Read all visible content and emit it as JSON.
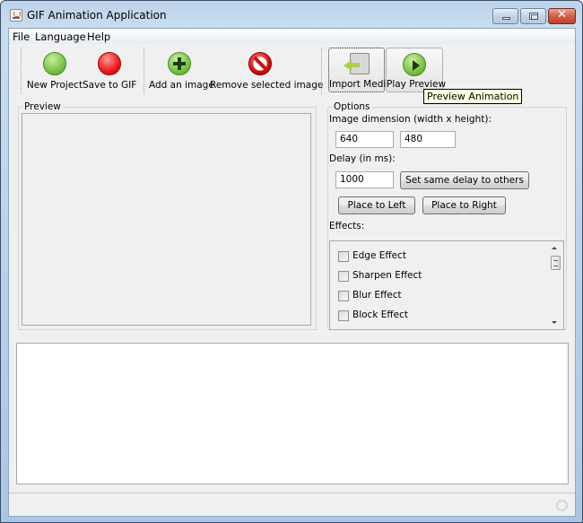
{
  "window": {
    "title": "GIF Animation Application",
    "controls": {
      "minimize_icon": "minimize-icon",
      "maximize_icon": "maximize-icon",
      "close_glyph": "✕"
    }
  },
  "menubar": {
    "items": [
      {
        "label": "File"
      },
      {
        "label": "Language"
      },
      {
        "label": "Help"
      }
    ]
  },
  "toolbar": {
    "buttons": [
      {
        "label": "New Project",
        "icon": "green-circle-icon"
      },
      {
        "label": "Save to GIF",
        "icon": "red-circle-icon"
      },
      {
        "label": "Add an image",
        "icon": "add-icon"
      },
      {
        "label": "Remove selected image",
        "icon": "no-sign-icon"
      },
      {
        "label": "Import Media",
        "icon": "import-media-icon"
      },
      {
        "label": "Play Preview",
        "icon": "play-icon"
      }
    ],
    "tooltip": "Preview Animation"
  },
  "preview": {
    "title": "Preview"
  },
  "options": {
    "title": "Options",
    "dimension_label": "Image dimension (width x height):",
    "width_value": "640",
    "height_value": "480",
    "delay_label": "Delay (in ms):",
    "delay_value": "1000",
    "same_delay_button": "Set same delay to others",
    "place_left_button": "Place to Left",
    "place_right_button": "Place to Right",
    "effects_label": "Effects:",
    "effects": [
      {
        "label": "Edge Effect",
        "checked": false
      },
      {
        "label": "Sharpen Effect",
        "checked": false
      },
      {
        "label": "Blur Effect",
        "checked": false
      },
      {
        "label": "Block Effect",
        "checked": false
      }
    ]
  },
  "log": {
    "text": ""
  },
  "status": {
    "text": ""
  }
}
